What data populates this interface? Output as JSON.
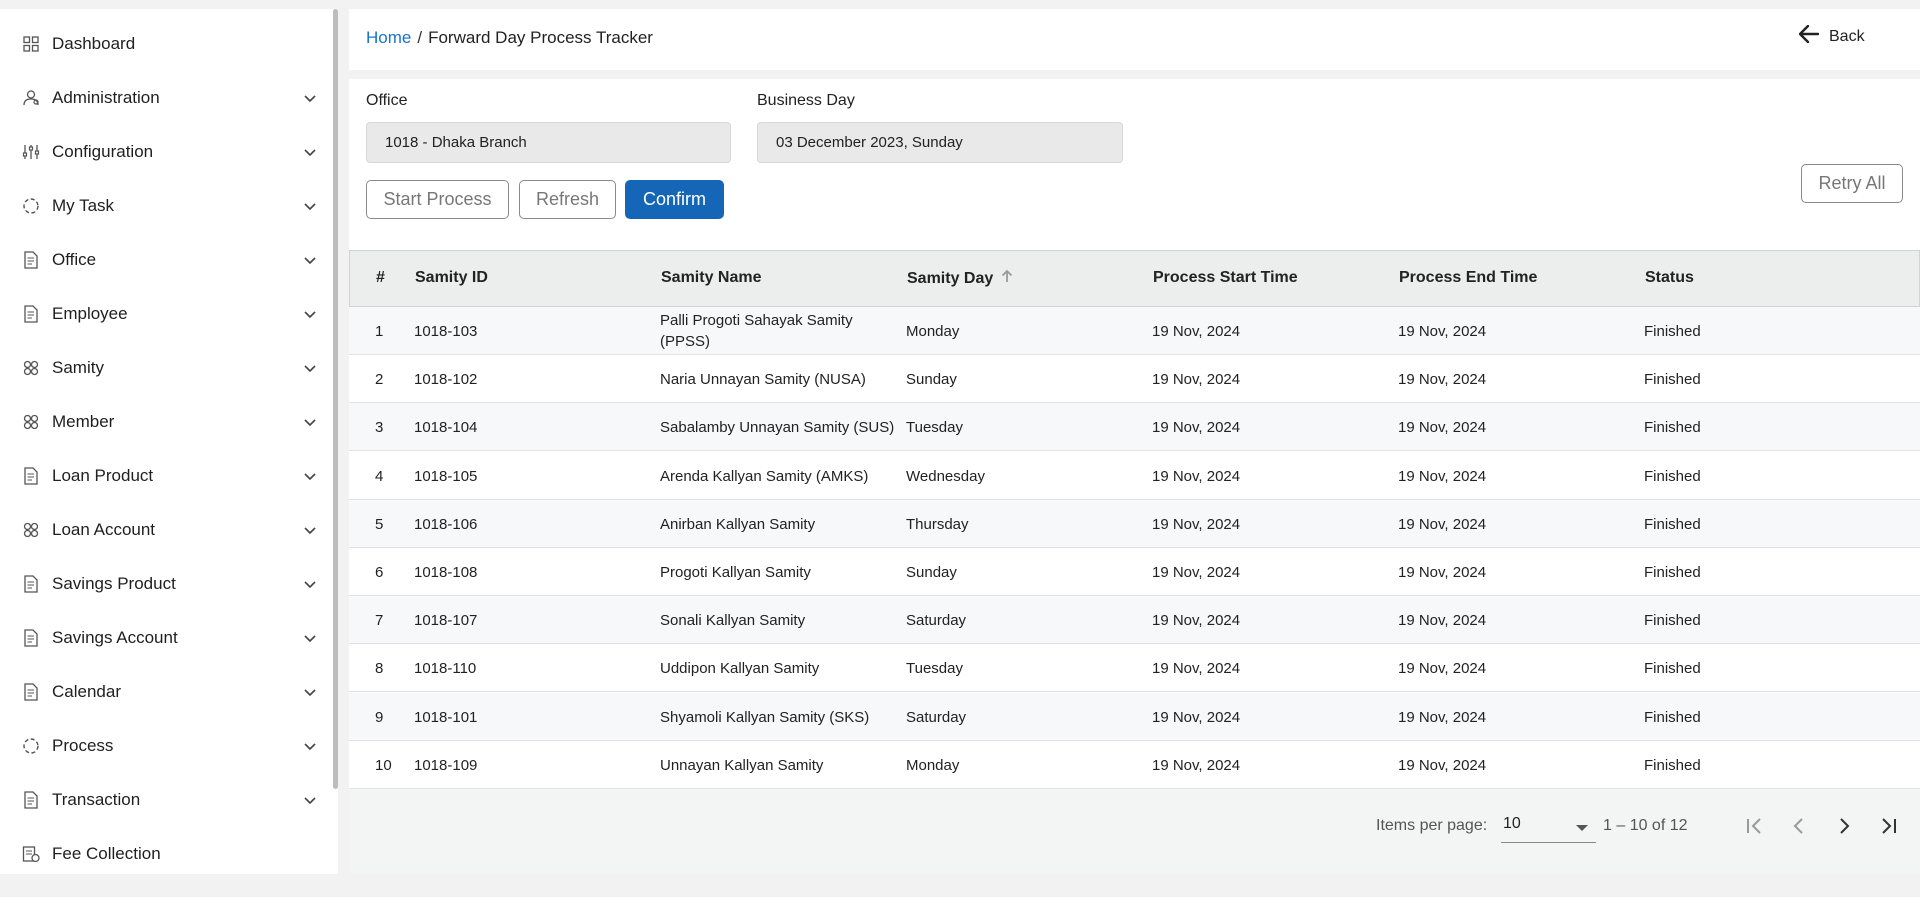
{
  "sidebar": {
    "items": [
      {
        "label": "Dashboard",
        "icon": "grid-icon",
        "expandable": false
      },
      {
        "label": "Administration",
        "icon": "admin-user-icon",
        "expandable": true
      },
      {
        "label": "Configuration",
        "icon": "sliders-icon",
        "expandable": true
      },
      {
        "label": "My Task",
        "icon": "circle-dashed-icon",
        "expandable": true
      },
      {
        "label": "Office",
        "icon": "document-icon",
        "expandable": true
      },
      {
        "label": "Employee",
        "icon": "document-icon",
        "expandable": true
      },
      {
        "label": "Samity",
        "icon": "group-icon",
        "expandable": true
      },
      {
        "label": "Member",
        "icon": "group-icon",
        "expandable": true
      },
      {
        "label": "Loan Product",
        "icon": "document-icon",
        "expandable": true
      },
      {
        "label": "Loan Account",
        "icon": "group-icon",
        "expandable": true
      },
      {
        "label": "Savings Product",
        "icon": "document-icon",
        "expandable": true
      },
      {
        "label": "Savings Account",
        "icon": "document-icon",
        "expandable": true
      },
      {
        "label": "Calendar",
        "icon": "document-icon",
        "expandable": true
      },
      {
        "label": "Process",
        "icon": "circle-dashed-icon",
        "expandable": true
      },
      {
        "label": "Transaction",
        "icon": "document-icon",
        "expandable": true
      },
      {
        "label": "Fee Collection",
        "icon": "fee-icon",
        "expandable": false
      }
    ]
  },
  "header": {
    "breadcrumb_home": "Home",
    "breadcrumb_sep": "/",
    "breadcrumb_current": "Forward Day Process Tracker",
    "back_label": "Back"
  },
  "form": {
    "office_label": "Office",
    "office_value": "1018 - Dhaka Branch",
    "business_day_label": "Business Day",
    "business_day_value": "03 December 2023, Sunday"
  },
  "actions": {
    "start_process": "Start Process",
    "refresh": "Refresh",
    "confirm": "Confirm",
    "retry_all": "Retry All"
  },
  "table": {
    "columns": [
      "#",
      "Samity ID",
      "Samity Name",
      "Samity Day",
      "Process Start Time",
      "Process End Time",
      "Status"
    ],
    "sorted_column": "Samity Day",
    "sort_direction": "ascending",
    "rows": [
      {
        "no": "1",
        "id": "1018-103",
        "name": "Palli Progoti Sahayak Samity (PPSS)",
        "day": "Monday",
        "start": "19 Nov, 2024",
        "end": "19 Nov, 2024",
        "status": "Finished"
      },
      {
        "no": "2",
        "id": "1018-102",
        "name": "Naria Unnayan Samity (NUSA)",
        "day": "Sunday",
        "start": "19 Nov, 2024",
        "end": "19 Nov, 2024",
        "status": "Finished"
      },
      {
        "no": "3",
        "id": "1018-104",
        "name": "Sabalamby Unnayan Samity (SUS)",
        "day": "Tuesday",
        "start": "19 Nov, 2024",
        "end": "19 Nov, 2024",
        "status": "Finished"
      },
      {
        "no": "4",
        "id": "1018-105",
        "name": "Arenda Kallyan Samity (AMKS)",
        "day": "Wednesday",
        "start": "19 Nov, 2024",
        "end": "19 Nov, 2024",
        "status": "Finished"
      },
      {
        "no": "5",
        "id": "1018-106",
        "name": "Anirban Kallyan Samity",
        "day": "Thursday",
        "start": "19 Nov, 2024",
        "end": "19 Nov, 2024",
        "status": "Finished"
      },
      {
        "no": "6",
        "id": "1018-108",
        "name": "Progoti Kallyan Samity",
        "day": "Sunday",
        "start": "19 Nov, 2024",
        "end": "19 Nov, 2024",
        "status": "Finished"
      },
      {
        "no": "7",
        "id": "1018-107",
        "name": "Sonali Kallyan Samity",
        "day": "Saturday",
        "start": "19 Nov, 2024",
        "end": "19 Nov, 2024",
        "status": "Finished"
      },
      {
        "no": "8",
        "id": "1018-110",
        "name": "Uddipon Kallyan Samity",
        "day": "Tuesday",
        "start": "19 Nov, 2024",
        "end": "19 Nov, 2024",
        "status": "Finished"
      },
      {
        "no": "9",
        "id": "1018-101",
        "name": "Shyamoli Kallyan Samity (SKS)",
        "day": "Saturday",
        "start": "19 Nov, 2024",
        "end": "19 Nov, 2024",
        "status": "Finished"
      },
      {
        "no": "10",
        "id": "1018-109",
        "name": "Unnayan Kallyan Samity",
        "day": "Monday",
        "start": "19 Nov, 2024",
        "end": "19 Nov, 2024",
        "status": "Finished"
      }
    ]
  },
  "paginator": {
    "items_per_page_label": "Items per page:",
    "items_per_page_value": "10",
    "range_label": "1 – 10 of 12"
  },
  "colors": {
    "primary": "#1566b7",
    "link": "#1a73c8"
  }
}
